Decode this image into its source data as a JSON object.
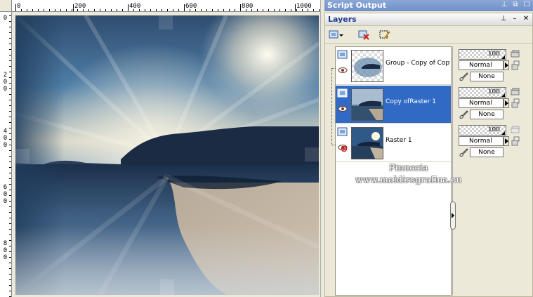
{
  "script_output": {
    "title": "Script Output",
    "buttons": [
      "pin-icon",
      "restore-icon",
      "maximize-icon"
    ]
  },
  "layers_panel": {
    "title": "Layers",
    "title_buttons": [
      "pin-icon",
      "minimize-icon",
      "close-icon"
    ],
    "toolbar": [
      "new-layer-icon",
      "delete-layer-icon",
      "edit-selection-icon"
    ]
  },
  "layers": [
    {
      "name": "Group - Copy of Copy",
      "selected": false,
      "opacity": "100",
      "blend": "Normal",
      "brush": "None",
      "visible": true
    },
    {
      "name": "Copy ofRaster 1",
      "selected": true,
      "opacity": "100",
      "blend": "Normal",
      "brush": "None",
      "visible": true
    },
    {
      "name": "Raster 1",
      "selected": false,
      "opacity": "100",
      "blend": "Normal",
      "brush": "None",
      "visible": false
    }
  ],
  "ruler": {
    "top_labels": [
      "0",
      "200",
      "400",
      "600",
      "800",
      "1000"
    ],
    "left_labels": [
      [
        "0"
      ],
      [
        "2",
        "0",
        "0"
      ],
      [
        "4",
        "0",
        "0"
      ],
      [
        "6",
        "0",
        "0"
      ],
      [
        "8",
        "0",
        "0"
      ]
    ]
  },
  "watermark": {
    "line1": "Pinuccia",
    "line2": "www.maldiregrafica.eu"
  },
  "colors": {
    "selection": "#316ac5",
    "panel_bg": "#ece9d8",
    "script_title_bar": "#7a97cd"
  }
}
